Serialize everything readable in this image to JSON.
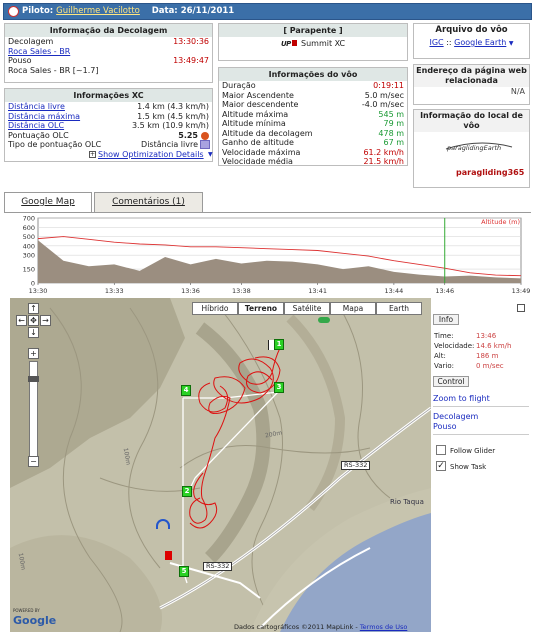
{
  "header": {
    "pilot_label": "Piloto:",
    "pilot_name": "Guilherme Vacilotto",
    "date_label": "Data:",
    "date_value": "26/11/2011"
  },
  "takeoff_panel": {
    "title": "Informação da Decolagem",
    "rows": [
      {
        "label": "Decolagem",
        "value": "13:30:36"
      },
      {
        "label": "Roca Sales - BR",
        "value": ""
      },
      {
        "label": "Pouso",
        "value": "13:49:47"
      },
      {
        "label": "Roca Sales - BR [~1.7]",
        "value": ""
      }
    ]
  },
  "xc_panel": {
    "title": "Informações XC",
    "rows": [
      {
        "label": "Distância livre",
        "value": "1.4 km (4.3 km/h)"
      },
      {
        "label": "Distância máxima",
        "value": "1.5 km (4.5 km/h)"
      },
      {
        "label": "Distância OLC",
        "value": "3.5 km (10.9 km/h)"
      },
      {
        "label": "Pontuação OLC",
        "value": "5.25"
      },
      {
        "label": "Tipo de pontuação OLC",
        "value": "Distância livre"
      }
    ],
    "show_optimization": "Show Optimization Details"
  },
  "glider_panel": {
    "title": "[ Parapente ]",
    "brand": "UP",
    "model": "Summit XC"
  },
  "flight_info_panel": {
    "title": "Informações do vôo",
    "rows": [
      {
        "label": "Duração",
        "value": "0:19:11"
      },
      {
        "label": "Maior Ascendente",
        "value": "5.0 m/sec"
      },
      {
        "label": "Maior descendente",
        "value": "-4.0 m/sec"
      },
      {
        "label": "Altitude máxima",
        "value": "545 m"
      },
      {
        "label": "Altitude mínima",
        "value": "79 m"
      },
      {
        "label": "Altitude da decolagem",
        "value": "478 m"
      },
      {
        "label": "Ganho de altitude",
        "value": "67 m"
      },
      {
        "label": "Velocidade máxima",
        "value": "61.2 km/h"
      },
      {
        "label": "Velocidade média",
        "value": "21.5 km/h"
      }
    ]
  },
  "file_panel": {
    "title": "Arquivo do vôo",
    "igc": "IGC",
    "sep": "::",
    "google_earth": "Google Earth"
  },
  "address_panel": {
    "title": "Endereço da página web relacionada",
    "value": "N/A"
  },
  "site_panel": {
    "title": "Informação do local de vôo",
    "logo_text": "paraglidingEarth",
    "logo_sub_text": "paragliding365"
  },
  "tabs": [
    {
      "label": "Google Map",
      "active": true
    },
    {
      "label": "Comentários (1)",
      "active": false
    }
  ],
  "altitude_chart": {
    "legend": "Altitude (m)"
  },
  "chart_data": {
    "type": "area",
    "xlabel": "",
    "ylabel": "",
    "x_ticks": [
      "13:30",
      "13:33",
      "13:36",
      "13:38",
      "13:41",
      "13:44",
      "13:46",
      "13:49"
    ],
    "y_ticks": [
      "700",
      "600",
      "500",
      "400",
      "300",
      "150",
      "0"
    ],
    "ylim": [
      0,
      700
    ],
    "series": [
      {
        "name": "Altitude (m)",
        "color": "#dd3333",
        "x": [
          "13:30",
          "13:31",
          "13:32",
          "13:33",
          "13:34",
          "13:35",
          "13:36",
          "13:37",
          "13:38",
          "13:39",
          "13:40",
          "13:41",
          "13:42",
          "13:43",
          "13:44",
          "13:45",
          "13:46",
          "13:47",
          "13:48",
          "13:49"
        ],
        "values": [
          478,
          500,
          470,
          440,
          420,
          410,
          390,
          390,
          380,
          370,
          360,
          350,
          320,
          290,
          240,
          200,
          160,
          110,
          85,
          79
        ]
      }
    ],
    "ground": {
      "color": "#9b8e80",
      "x": [
        "13:30",
        "13:31",
        "13:32",
        "13:33",
        "13:34",
        "13:35",
        "13:36",
        "13:37",
        "13:38",
        "13:39",
        "13:40",
        "13:41",
        "13:42",
        "13:43",
        "13:44",
        "13:45",
        "13:46",
        "13:47",
        "13:48",
        "13:49"
      ],
      "values": [
        460,
        240,
        180,
        200,
        130,
        280,
        200,
        260,
        210,
        240,
        230,
        200,
        150,
        180,
        120,
        90,
        70,
        80,
        60,
        50
      ]
    },
    "cursor_x": "13:46"
  },
  "map": {
    "type_buttons": [
      "Híbrido",
      "Terreno",
      "Satélite",
      "Mapa",
      "Earth"
    ],
    "active_type": "Terreno",
    "road_labels": [
      "RS-332",
      "RS-332"
    ],
    "river_label": "Rio Taqua",
    "contour_labels": [
      "200m",
      "100m",
      "100m"
    ],
    "markers": [
      "1",
      "2",
      "3",
      "4",
      "5"
    ],
    "attribution": "Dados cartográficos ©2011 MapLink -",
    "terms": "Termos de Uso",
    "powered_by": "POWERED BY",
    "google": "Google"
  },
  "info_side": {
    "info_button": "Info",
    "time_label": "Time:",
    "time_value": "13:46",
    "speed_label": "Velocidade:",
    "speed_value": "14.6 km/h",
    "alt_label": "Alt:",
    "alt_value": "186 m",
    "vario_label": "Vario:",
    "vario_value": "0 m/sec",
    "control_button": "Control",
    "zoom_to_flight": "Zoom to flight",
    "takeoff_link": "Decolagem",
    "landing_link": "Pouso",
    "follow_glider": "Follow Glider",
    "show_task": "Show Task",
    "show_task_checked": true,
    "follow_glider_checked": false
  }
}
